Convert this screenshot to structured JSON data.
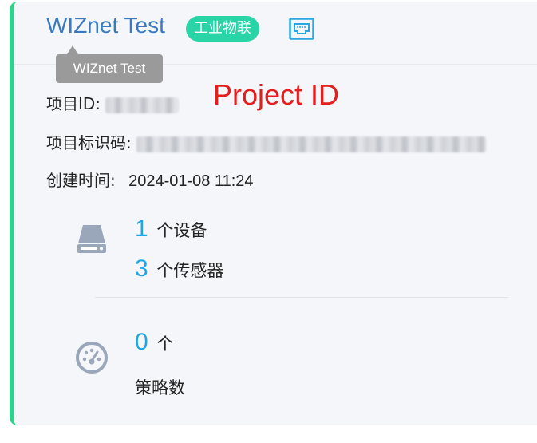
{
  "project": {
    "name": "WIZnet Test",
    "tag": "工业物联",
    "icon": "network-port-icon"
  },
  "tooltip": {
    "text": "WIZnet Test"
  },
  "fields": {
    "project_id_label": "项目ID:",
    "project_key_label": "项目标识码:",
    "created_label": "创建时间:",
    "created_value": "2024-01-08 11:24"
  },
  "annotation": {
    "text": "Project ID",
    "color": "#e41d1d"
  },
  "stats": {
    "devices": {
      "count": "1",
      "label": "个设备",
      "icon": "hard-drive-icon"
    },
    "sensors": {
      "count": "3",
      "label": "个传感器"
    },
    "strategies": {
      "count": "0",
      "unit": "个",
      "label": "策略数",
      "icon": "gauge-icon"
    }
  },
  "colors": {
    "accent_bar": "#2fd28a",
    "tag_bg": "#29d4a7",
    "title": "#3a79c0",
    "number": "#1ea7e4"
  }
}
